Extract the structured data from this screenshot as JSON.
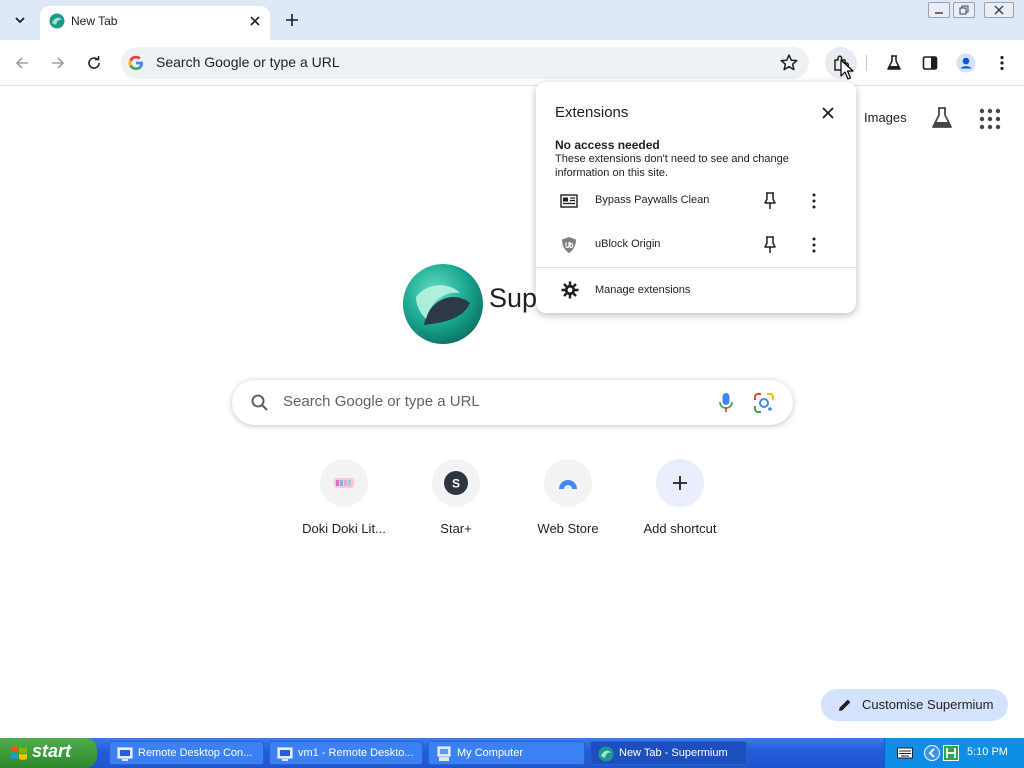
{
  "browser": {
    "tab": {
      "title": "New Tab"
    },
    "omnibox": {
      "text": "Search Google or type a URL"
    }
  },
  "page": {
    "header_links": {
      "images": "Images"
    },
    "logo_text": "Sup",
    "search": {
      "placeholder": "Search Google or type a URL"
    },
    "shortcuts": [
      {
        "label": "Doki Doki Lit...",
        "icon": "doki-doki-favicon"
      },
      {
        "label": "Star+",
        "icon": "star-plus-letter-icon",
        "letter": "S"
      },
      {
        "label": "Web Store",
        "icon": "web-store-icon"
      },
      {
        "label": "Add shortcut",
        "icon": "plus-icon"
      }
    ],
    "customise_label": "Customise Supermium"
  },
  "extensions_popup": {
    "title": "Extensions",
    "section_heading": "No access needed",
    "section_desc": "These extensions don't need to see and change information on this site.",
    "items": [
      {
        "name": "Bypass Paywalls Clean",
        "icon": "newspaper-icon"
      },
      {
        "name": "uBlock Origin",
        "icon": "ublock-shield-icon"
      }
    ],
    "manage_label": "Manage extensions"
  },
  "taskbar": {
    "start_label": "start",
    "tasks": [
      {
        "label": "Remote Desktop Con...",
        "icon": "remote-desktop-icon"
      },
      {
        "label": "vm1 - Remote Deskto...",
        "icon": "remote-desktop-icon"
      },
      {
        "label": "My Computer",
        "icon": "computer-icon"
      },
      {
        "label": "New Tab - Supermium",
        "icon": "supermium-icon"
      }
    ],
    "clock": "5:10 PM"
  },
  "colors": {
    "tabstrip": "#dfe8f6",
    "omnibox": "#eef1f6",
    "customise_button": "#d3e3fd",
    "taskbar": "#245edb",
    "start_button": "#379a37"
  }
}
